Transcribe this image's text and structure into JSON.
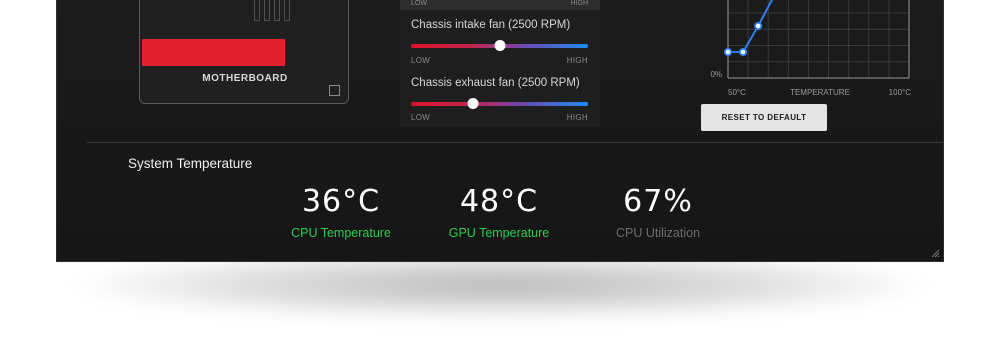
{
  "motherboard": {
    "label": "MOTHERBOARD"
  },
  "fans": {
    "previous": {
      "low": "LOW",
      "high": "HIGH"
    },
    "items": [
      {
        "title": "Chassis intake fan (2500 RPM)",
        "low": "LOW",
        "high": "HIGH",
        "value": 0.5
      },
      {
        "title": "Chassis exhaust fan (2500 RPM)",
        "low": "LOW",
        "high": "HIGH",
        "value": 0.35
      }
    ],
    "gradient": {
      "low_color": "#e0132a",
      "high_color": "#1c8cf0"
    }
  },
  "chart_data": {
    "type": "line",
    "title": "",
    "xlabel": "TEMPERATURE",
    "ylabel": "",
    "x_tick_labels": [
      "50°C",
      "100°C"
    ],
    "y_tick_labels": [
      "0%"
    ],
    "xlim": [
      40,
      100
    ],
    "ylim": [
      0,
      100
    ],
    "grid": true,
    "series": [
      {
        "x": [
          40,
          45,
          50,
          55,
          60,
          65,
          70
        ],
        "y": [
          20,
          20,
          40,
          62,
          62,
          82,
          102
        ],
        "color": "#2f7ff0"
      }
    ]
  },
  "reset_button": {
    "label": "RESET TO DEFAULT"
  },
  "system_temperature": {
    "title": "System Temperature",
    "stats": [
      {
        "value": "36°C",
        "label": "CPU Temperature",
        "color": "#2ecc4f"
      },
      {
        "value": "48°C",
        "label": "GPU Temperature",
        "color": "#2ecc4f"
      },
      {
        "value": "67%",
        "label": "CPU Utilization",
        "color": "#6e6e6e"
      }
    ]
  }
}
